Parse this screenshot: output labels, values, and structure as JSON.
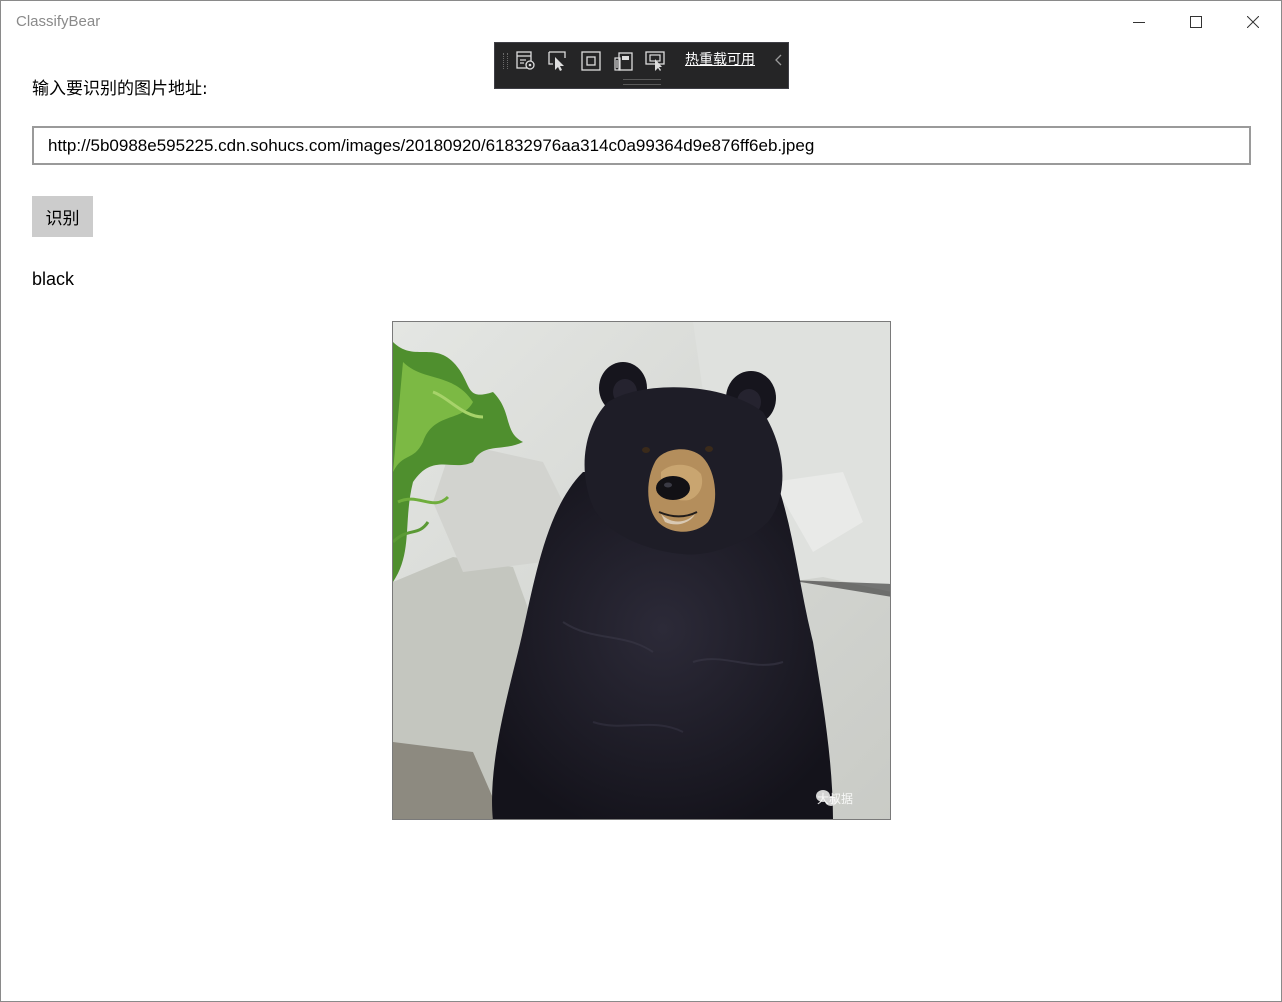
{
  "window": {
    "title": "ClassifyBear"
  },
  "debug_toolbar": {
    "hot_reload_label": "热重载可用"
  },
  "main": {
    "prompt_label": "输入要识别的图片地址:",
    "url_value": "http://5b0988e595225.cdn.sohucs.com/images/20180920/61832976aa314c0a99364d9e876ff6eb.jpeg",
    "recognize_button_label": "识别",
    "result": "black"
  },
  "photo": {
    "subject": "black bear",
    "watermark": "大叔据"
  },
  "colors": {
    "button_bg": "#cccccc",
    "toolbar_bg": "#252526",
    "input_border": "#9a9a9a",
    "title_color": "#8a8a8a"
  }
}
